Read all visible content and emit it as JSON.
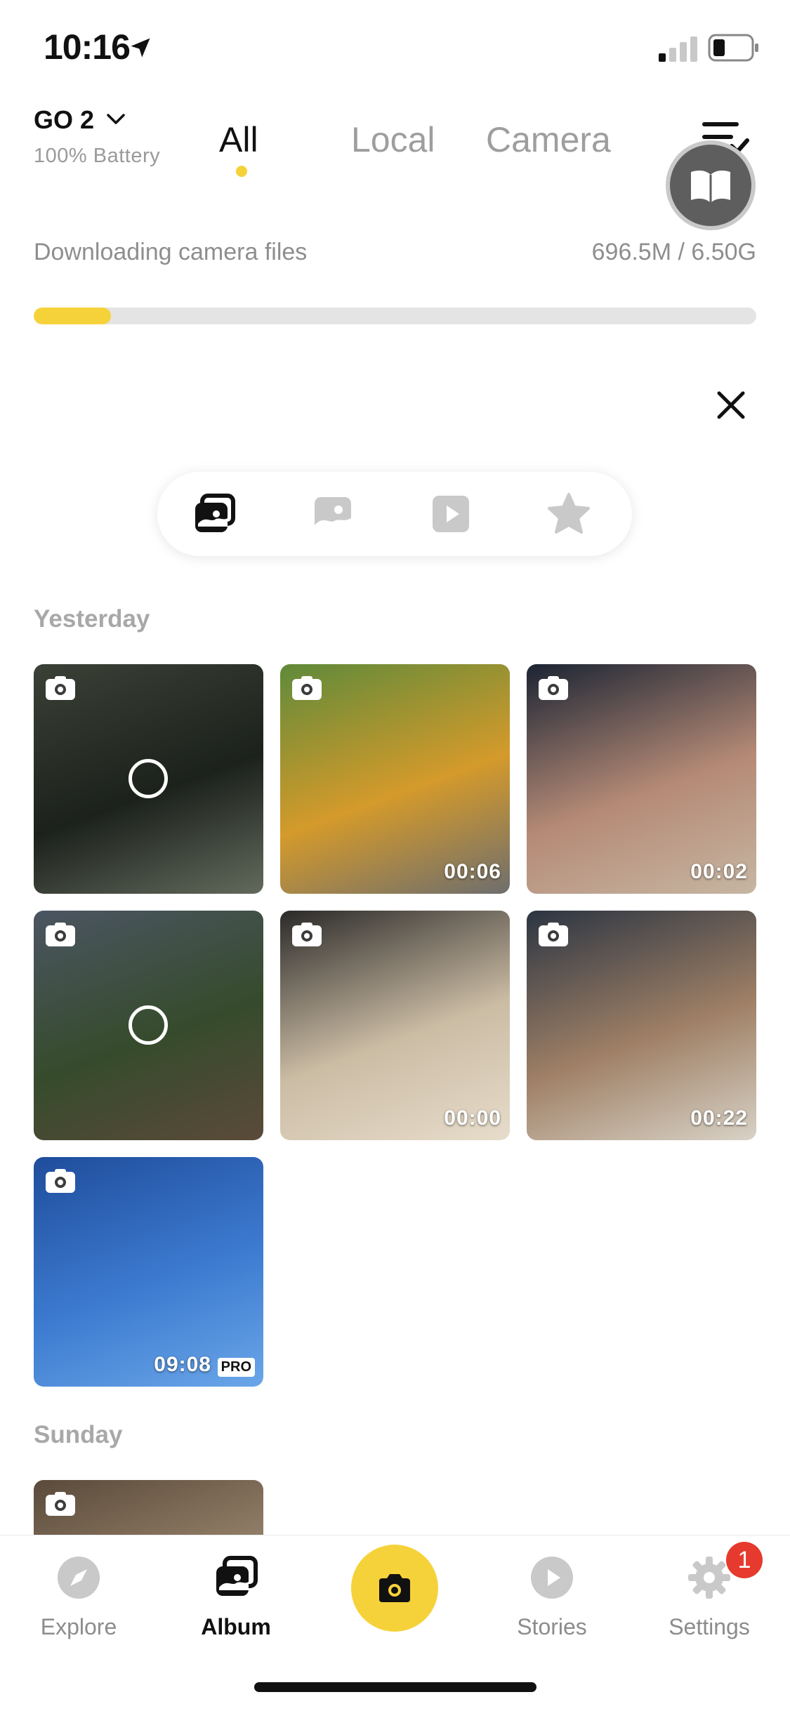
{
  "status": {
    "time": "10:16"
  },
  "header": {
    "device_name": "GO 2",
    "battery": "100% Battery",
    "tabs": [
      {
        "label": "All",
        "active": true
      },
      {
        "label": "Local",
        "active": false
      },
      {
        "label": "Camera",
        "active": false
      }
    ]
  },
  "download": {
    "label": "Downloading camera files",
    "size": "696.5M / 6.50G",
    "progress_fraction": 0.107
  },
  "filters": [
    "all-media-icon",
    "photo-icon",
    "video-icon",
    "star-icon"
  ],
  "sections": [
    {
      "title": "Yesterday",
      "items": [
        {
          "duration": "",
          "selected_ring": true,
          "colors": [
            "#3b4136",
            "#1c211c",
            "#626a5c"
          ]
        },
        {
          "duration": "00:06",
          "selected_ring": false,
          "colors": [
            "#5f8a3a",
            "#d49a2b",
            "#6e6e6e"
          ]
        },
        {
          "duration": "00:02",
          "selected_ring": false,
          "colors": [
            "#1b2433",
            "#b58a76",
            "#c6b6a2"
          ]
        },
        {
          "duration": "",
          "selected_ring": true,
          "colors": [
            "#4b5562",
            "#364b2c",
            "#5b4a3a"
          ]
        },
        {
          "duration": "00:00",
          "selected_ring": false,
          "colors": [
            "#2b2a29",
            "#cbbca4",
            "#e7dccb"
          ]
        },
        {
          "duration": "00:22",
          "selected_ring": false,
          "colors": [
            "#2c3542",
            "#9f8066",
            "#d8d2c6"
          ]
        },
        {
          "duration": "09:08",
          "pro": "PRO",
          "selected_ring": false,
          "colors": [
            "#1f4d9c",
            "#3d7bd0",
            "#6aa6e8"
          ]
        }
      ]
    },
    {
      "title": "Sunday",
      "items": [
        {
          "duration": "",
          "selected_ring": false,
          "colors": [
            "#5a4a3a",
            "#9f8a72",
            "#cbb89a"
          ]
        }
      ]
    }
  ],
  "nav": {
    "items": [
      {
        "label": "Explore",
        "active": false
      },
      {
        "label": "Album",
        "active": true
      },
      {
        "label": "Stories",
        "active": false
      },
      {
        "label": "Settings",
        "active": false
      }
    ],
    "badge": "1"
  },
  "colors": {
    "accent": "#f6d23a",
    "badge": "#e63a2e"
  }
}
